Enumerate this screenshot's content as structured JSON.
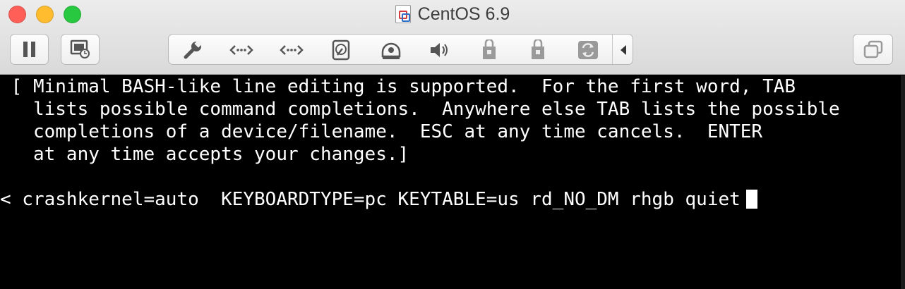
{
  "window": {
    "title": "CentOS 6.9"
  },
  "toolbar": {
    "pause_icon": "pause-icon",
    "snapshot_icon": "snapshot-icon",
    "group_icons": [
      "wrench-icon",
      "network-icon",
      "network-icon",
      "hard-disk-icon",
      "optical-disc-icon",
      "speaker-icon",
      "usb-lock-icon",
      "usb-lock-icon",
      "refresh-icon",
      "collapse-left-icon"
    ],
    "right_icon": "copy-windows-icon"
  },
  "console": {
    "lines": [
      " [ Minimal BASH-like line editing is supported.  For the first word, TAB",
      "   lists possible command completions.  Anywhere else TAB lists the possible",
      "   completions of a device/filename.  ESC at any time cancels.  ENTER",
      "   at any time accepts your changes.]",
      "",
      "< crashkernel=auto  KEYBOARDTYPE=pc KEYTABLE=us rd_NO_DM rhgb quiet"
    ]
  },
  "colors": {
    "close": "#ff5f57",
    "minimize": "#febc2e",
    "maximize": "#28c840",
    "console_bg": "#000000",
    "console_fg": "#ffffff"
  }
}
